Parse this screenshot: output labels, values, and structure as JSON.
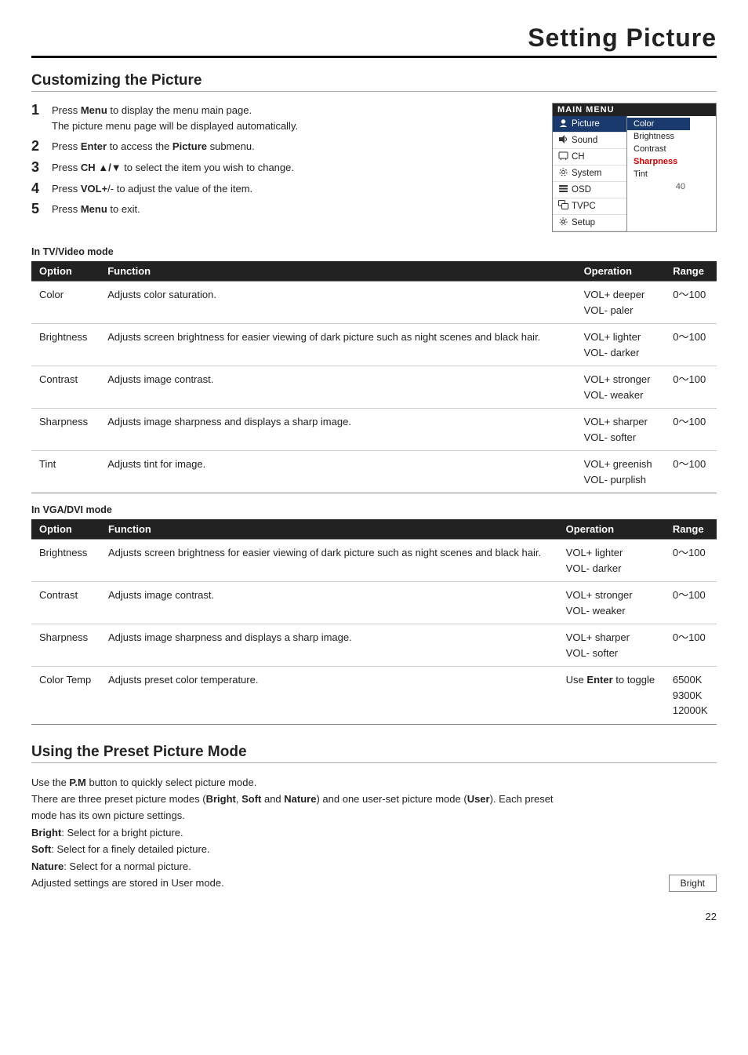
{
  "page_title": "Setting Picture",
  "section1": {
    "heading": "Customizing the Picture",
    "steps": [
      {
        "number": "1",
        "text": "Press ",
        "bold1": "Menu",
        "text2": " to display the menu main page.",
        "sub": "The picture menu page will be displayed automatically."
      },
      {
        "number": "2",
        "text": "Press ",
        "bold1": "Enter",
        "text2": " to access the ",
        "bold2": "Picture",
        "text3": " submenu."
      },
      {
        "number": "3",
        "text": "Press ",
        "bold1": "CH ▲/▼",
        "text2": " to select the item you wish to change."
      },
      {
        "number": "4",
        "text": "Press ",
        "bold1": "VOL+",
        "text2": "/- to adjust the value of the item."
      },
      {
        "number": "5",
        "text": "Press ",
        "bold1": "Menu",
        "text2": " to exit."
      }
    ],
    "main_menu": {
      "title": "MAIN MENU",
      "items": [
        {
          "icon": "👤",
          "label": "Picture",
          "selected": true
        },
        {
          "icon": "🔊",
          "label": "Sound",
          "selected": false
        },
        {
          "icon": "📺",
          "label": "CH",
          "selected": false
        },
        {
          "icon": "⚙",
          "label": "System",
          "selected": false
        },
        {
          "icon": "▤",
          "label": "OSD",
          "selected": false
        },
        {
          "icon": "📷",
          "label": "TVPC",
          "selected": false
        },
        {
          "icon": "⚙",
          "label": "Setup",
          "selected": false
        }
      ],
      "sub_items": [
        {
          "label": "Color",
          "highlighted": true
        },
        {
          "label": "Brightness",
          "highlighted": false
        },
        {
          "label": "Contrast",
          "highlighted": false
        },
        {
          "label": "Sharpness",
          "highlighted": false
        },
        {
          "label": "Tint",
          "highlighted": false
        }
      ],
      "number": "40"
    }
  },
  "tv_video_mode": {
    "label": "In TV/Video mode",
    "columns": [
      "Option",
      "Function",
      "Operation",
      "Range"
    ],
    "rows": [
      {
        "option": "Color",
        "function": "Adjusts color saturation.",
        "operation": "VOL+  deeper\nVOL-  paler",
        "range": "0～100"
      },
      {
        "option": "Brightness",
        "function": "Adjusts screen brightness for easier viewing of dark picture such as night scenes and black hair.",
        "operation": "VOL+  lighter\nVOL-  darker",
        "range": "0～100"
      },
      {
        "option": "Contrast",
        "function": "Adjusts image contrast.",
        "operation": "VOL+  stronger\nVOL-  weaker",
        "range": "0～100"
      },
      {
        "option": "Sharpness",
        "function": "Adjusts image sharpness and displays a sharp image.",
        "operation": "VOL+  sharper\nVOL-  softer",
        "range": "0～100"
      },
      {
        "option": "Tint",
        "function": "Adjusts tint for image.",
        "operation": "VOL+  greenish\nVOL-  purplish",
        "range": "0～100"
      }
    ]
  },
  "vga_dvi_mode": {
    "label": "In VGA/DVI mode",
    "columns": [
      "Option",
      "Function",
      "Operation",
      "Range"
    ],
    "rows": [
      {
        "option": "Brightness",
        "function": "Adjusts screen brightness for easier viewing of dark picture such as night scenes and black hair.",
        "operation": "VOL+  lighter\nVOL-  darker",
        "range": "0～100"
      },
      {
        "option": "Contrast",
        "function": "Adjusts image contrast.",
        "operation": "VOL+  stronger\nVOL-  weaker",
        "range": "0～100"
      },
      {
        "option": "Sharpness",
        "function": "Adjusts image sharpness and displays a sharp image.",
        "operation": "VOL+  sharper\nVOL-  softer",
        "range": "0～100"
      },
      {
        "option": "Color Temp",
        "function": "Adjusts preset color temperature.",
        "operation": "Use Enter to toggle",
        "range": "6500K\n9300K\n12000K"
      }
    ]
  },
  "section2": {
    "heading": "Using the Preset Picture Mode",
    "text_lines": [
      "Use the P.M button to quickly select picture mode.",
      "There are three preset picture modes (Bright, Soft and Nature) and one user-set picture mode (User). Each preset mode has its own picture settings.",
      "Bright: Select for a bright picture.",
      "Soft: Select for a finely detailed picture.",
      "Nature: Select for a normal picture.",
      "Adjusted settings are stored in User mode."
    ],
    "graphic_label": "Bright"
  },
  "page_number": "22"
}
